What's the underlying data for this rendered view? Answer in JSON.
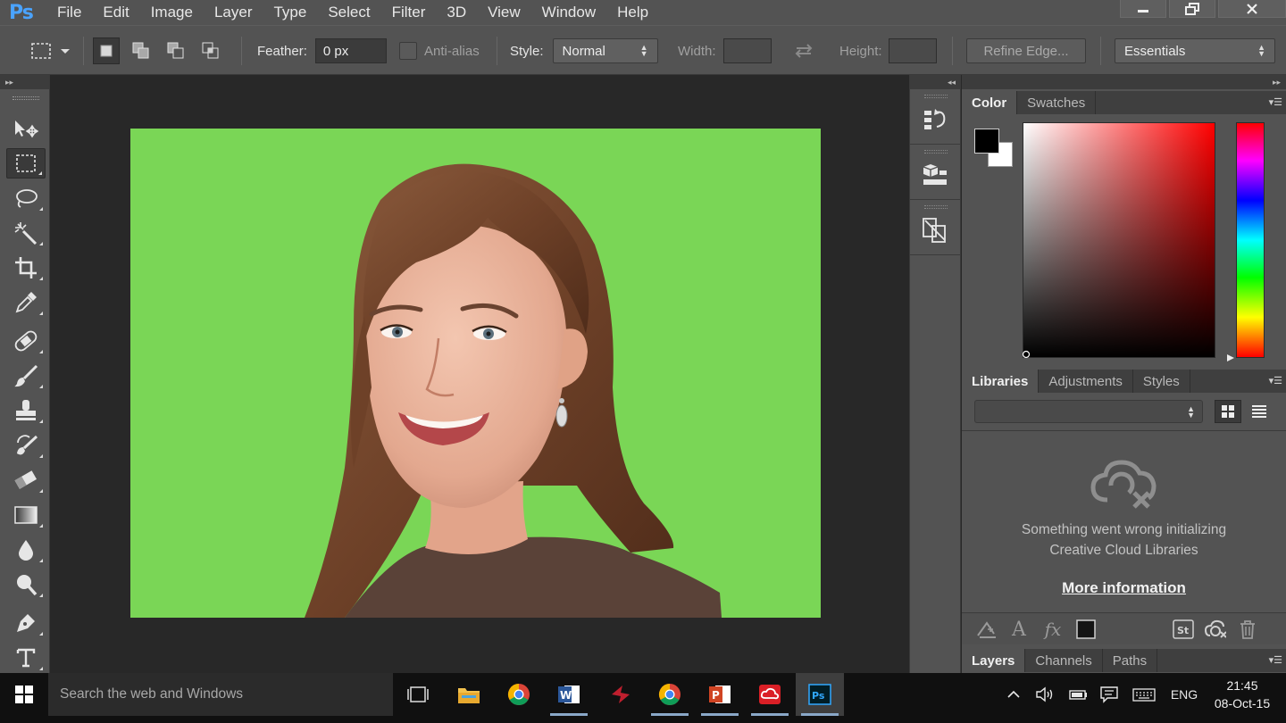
{
  "app": {
    "logo": "Ps"
  },
  "menu": [
    "File",
    "Edit",
    "Image",
    "Layer",
    "Type",
    "Select",
    "Filter",
    "3D",
    "View",
    "Window",
    "Help"
  ],
  "window_controls": {
    "minimize": "minimize-icon",
    "restore": "restore-icon",
    "close": "close-icon"
  },
  "options": {
    "feather_label": "Feather:",
    "feather_value": "0 px",
    "antialias_label": "Anti-alias",
    "style_label": "Style:",
    "style_value": "Normal",
    "width_label": "Width:",
    "height_label": "Height:",
    "refine_edge": "Refine Edge...",
    "workspace": "Essentials"
  },
  "tools": [
    "move-tool",
    "rectangular-marquee-tool",
    "lasso-tool",
    "magic-wand-tool",
    "crop-tool",
    "eyedropper-tool",
    "spot-healing-brush-tool",
    "brush-tool",
    "clone-stamp-tool",
    "history-brush-tool",
    "eraser-tool",
    "gradient-tool",
    "blur-tool",
    "dodge-tool",
    "pen-tool",
    "type-tool"
  ],
  "canvas": {
    "background_color": "#7ad656"
  },
  "color_panel": {
    "tabs": [
      "Color",
      "Swatches"
    ],
    "active_tab": "Color",
    "foreground": "#000000",
    "background": "#ffffff"
  },
  "libraries_panel": {
    "tabs": [
      "Libraries",
      "Adjustments",
      "Styles"
    ],
    "active_tab": "Libraries",
    "message_line1": "Something went wrong initializing",
    "message_line2": "Creative Cloud Libraries",
    "more_info": "More information"
  },
  "layers_panel": {
    "tabs": [
      "Layers",
      "Channels",
      "Paths"
    ],
    "active_tab": "Layers"
  },
  "taskbar": {
    "search_placeholder": "Search the web and Windows",
    "language": "ENG",
    "time": "21:45",
    "date": "08-Oct-15"
  }
}
